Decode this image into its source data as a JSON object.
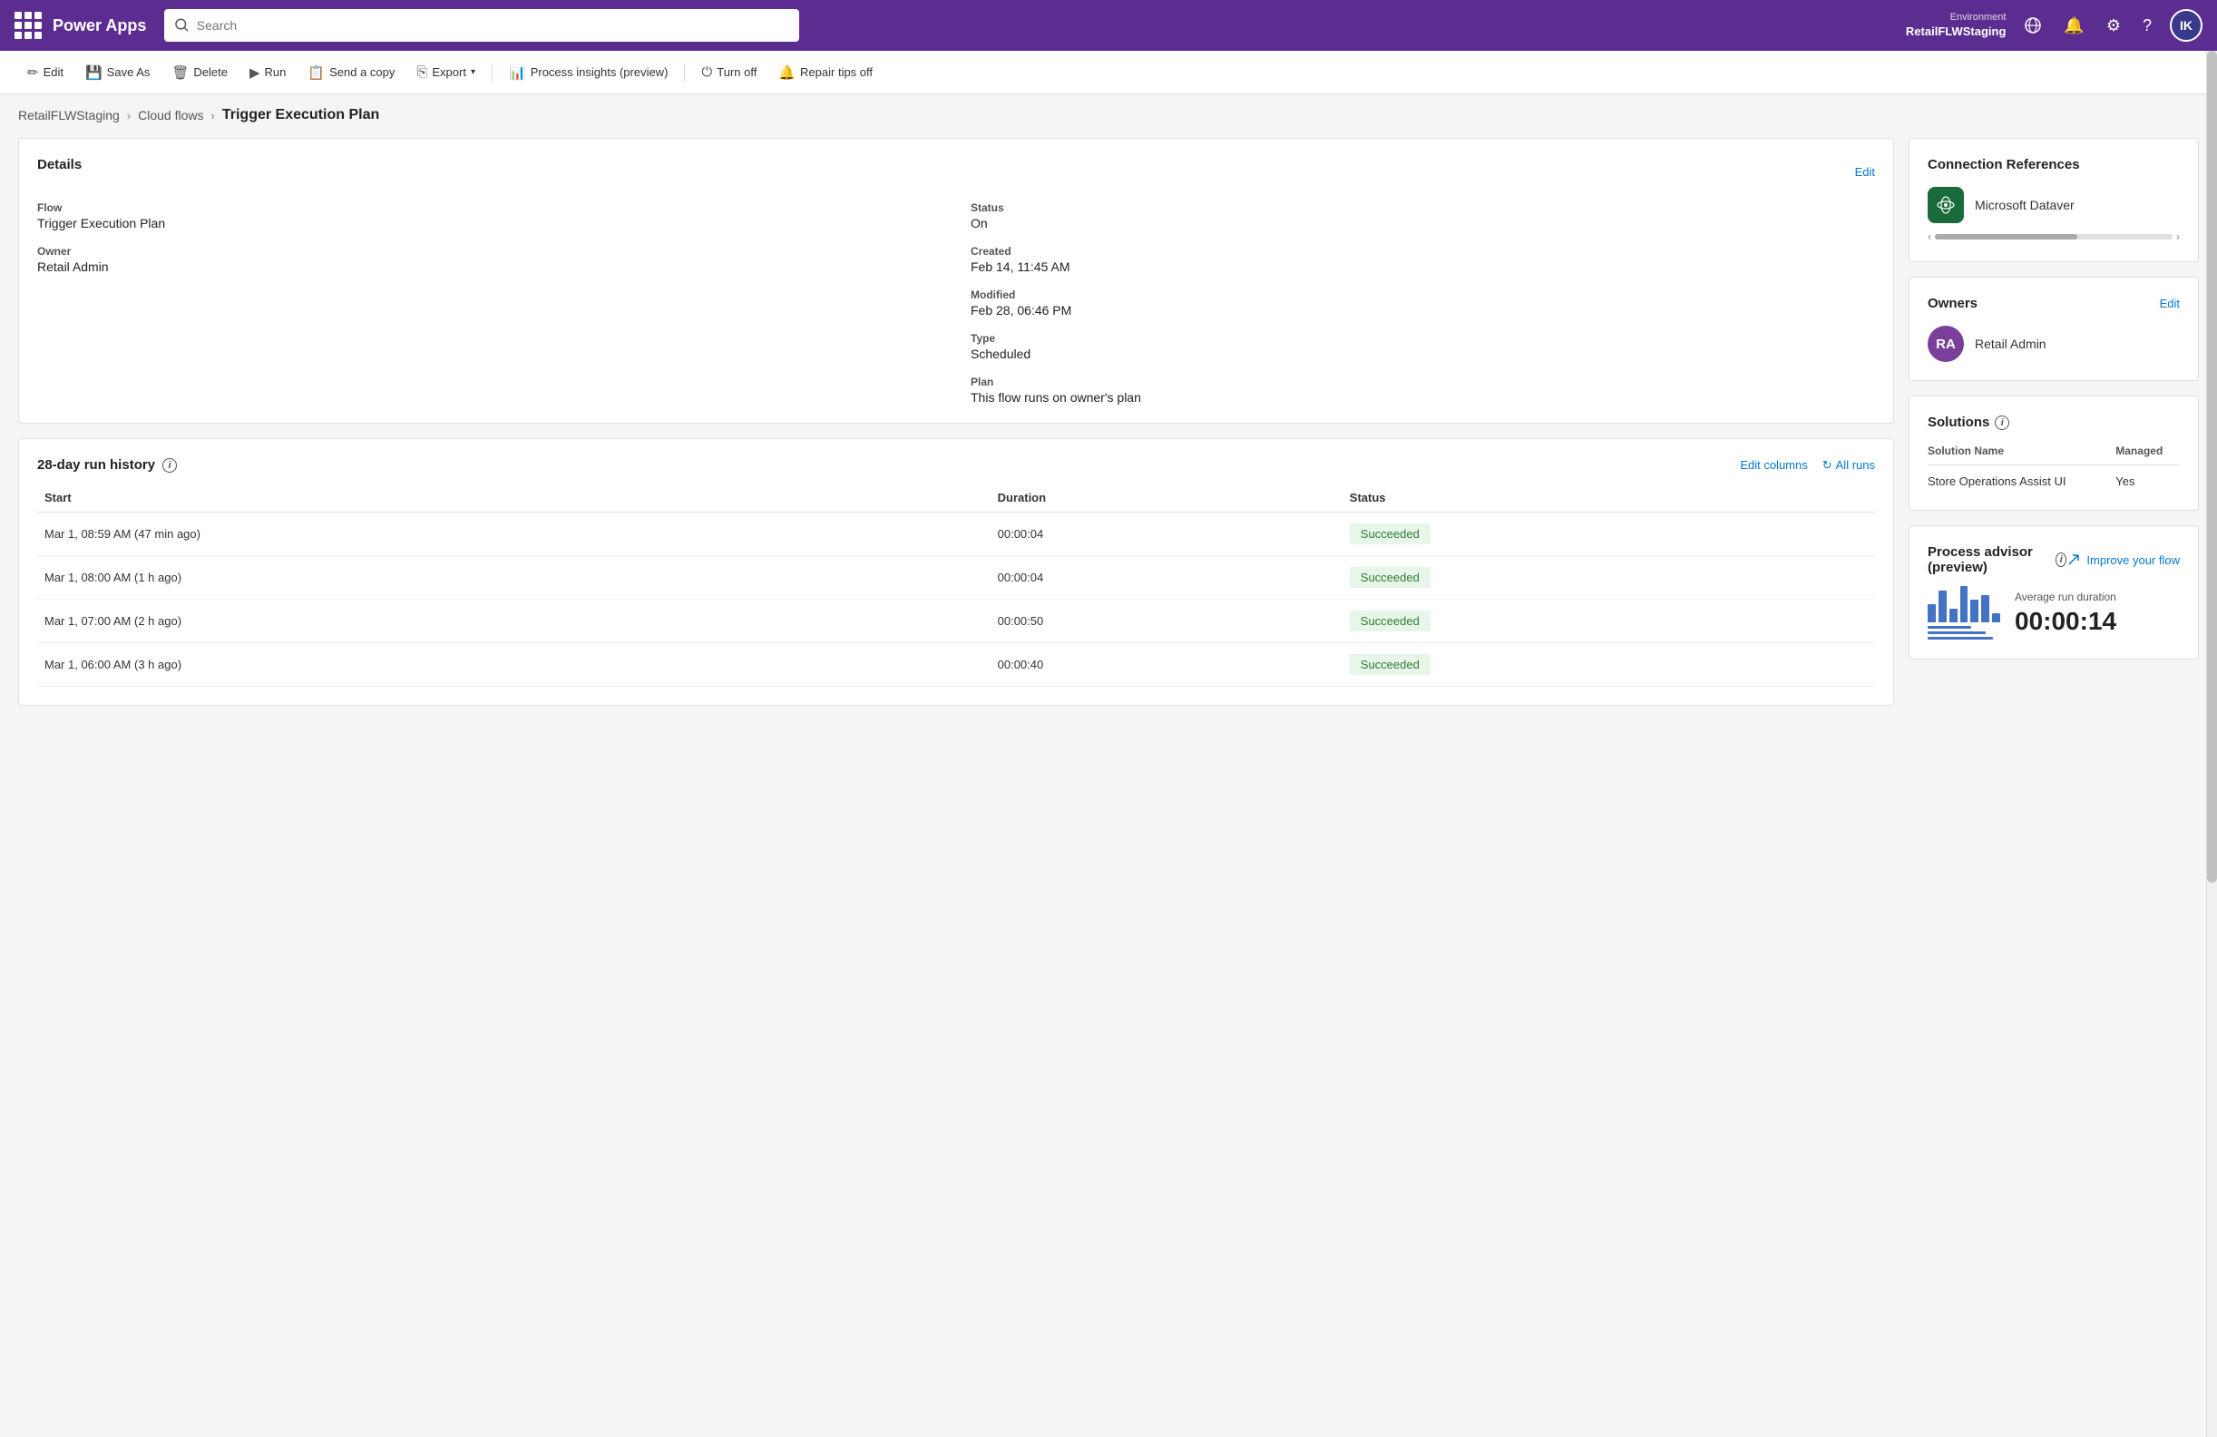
{
  "topnav": {
    "app_name": "Power Apps",
    "search_placeholder": "Search",
    "environment_label": "Environment",
    "environment_name": "RetailFLWStaging",
    "user_initials": "IK"
  },
  "toolbar": {
    "edit_label": "Edit",
    "save_as_label": "Save As",
    "delete_label": "Delete",
    "run_label": "Run",
    "send_copy_label": "Send a copy",
    "export_label": "Export",
    "process_insights_label": "Process insights (preview)",
    "turn_off_label": "Turn off",
    "repair_tips_label": "Repair tips off"
  },
  "breadcrumb": {
    "environment": "RetailFLWStaging",
    "section": "Cloud flows",
    "current": "Trigger Execution Plan"
  },
  "details": {
    "section_title": "Details",
    "edit_label": "Edit",
    "flow_label": "Flow",
    "flow_value": "Trigger Execution Plan",
    "owner_label": "Owner",
    "owner_value": "Retail Admin",
    "status_label": "Status",
    "status_value": "On",
    "created_label": "Created",
    "created_value": "Feb 14, 11:45 AM",
    "modified_label": "Modified",
    "modified_value": "Feb 28, 06:46 PM",
    "type_label": "Type",
    "type_value": "Scheduled",
    "plan_label": "Plan",
    "plan_value": "This flow runs on owner's plan"
  },
  "run_history": {
    "title": "28-day run history",
    "edit_columns_label": "Edit columns",
    "all_runs_label": "All runs",
    "columns": [
      "Start",
      "Duration",
      "Status"
    ],
    "rows": [
      {
        "start": "Mar 1, 08:59 AM (47 min ago)",
        "duration": "00:00:04",
        "status": "Succeeded"
      },
      {
        "start": "Mar 1, 08:00 AM (1 h ago)",
        "duration": "00:00:04",
        "status": "Succeeded"
      },
      {
        "start": "Mar 1, 07:00 AM (2 h ago)",
        "duration": "00:00:50",
        "status": "Succeeded"
      },
      {
        "start": "Mar 1, 06:00 AM (3 h ago)",
        "duration": "00:00:40",
        "status": "Succeeded"
      }
    ]
  },
  "connection_references": {
    "title": "Connection References",
    "connection_name": "Microsoft Dataver"
  },
  "owners": {
    "title": "Owners",
    "edit_label": "Edit",
    "owner_initials": "RA",
    "owner_name": "Retail Admin"
  },
  "solutions": {
    "title": "Solutions",
    "col_name": "Solution Name",
    "col_managed": "Managed",
    "rows": [
      {
        "name": "Store Operations Assist UI",
        "managed": "Yes"
      }
    ]
  },
  "process_advisor": {
    "title": "Process advisor (preview)",
    "improve_flow_label": "Improve your flow",
    "avg_label": "Average run duration",
    "avg_value": "00:00:14",
    "chart_bars": [
      20,
      35,
      15,
      40,
      25,
      30,
      10
    ],
    "chart_lines": [
      60,
      80,
      90
    ]
  }
}
